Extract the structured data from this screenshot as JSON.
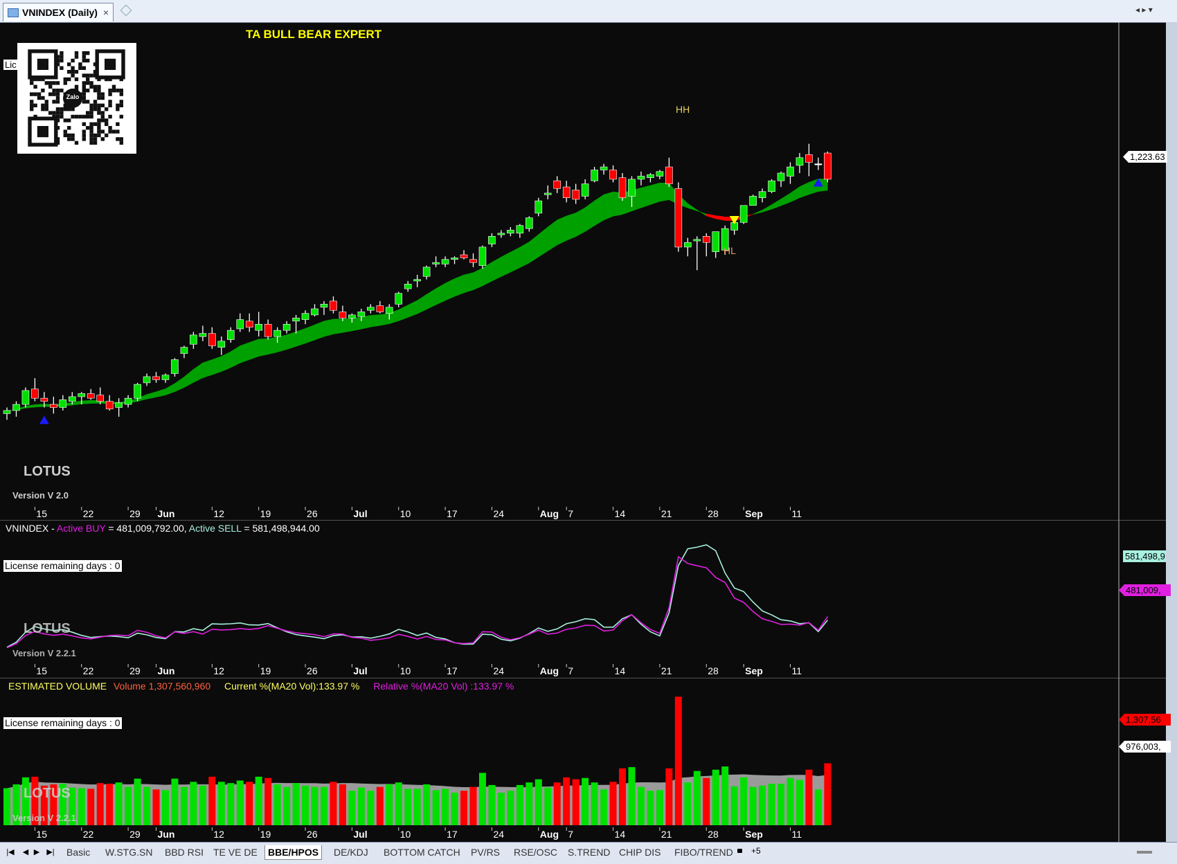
{
  "window": {
    "tab_title": "VNINDEX (Daily)",
    "close_glyph": "×"
  },
  "price_panel": {
    "title": "TA BULL BEAR EXPERT",
    "license_stub": "Lic",
    "qr_label": "Zalo",
    "watermark": "LOTUS",
    "version": "Version V 2.0",
    "last_price_label": "1,223.63",
    "markers": {
      "hh": "HH",
      "hl": "HL"
    },
    "x_labels": [
      "15",
      "22",
      "29",
      "Jun",
      "12",
      "19",
      "26",
      "Jul",
      "10",
      "17",
      "24",
      "Aug",
      "7",
      "14",
      "21",
      "28",
      "Sep",
      "11"
    ]
  },
  "active_panel": {
    "symbol": "VNINDEX - ",
    "buy_label": "Active BUY",
    "buy_text": " = 481,009,792.00, ",
    "sell_label": "Active SELL",
    "sell_text": " = 581,498,944.00",
    "license_text": "License remaining days : 0",
    "watermark": "LOTUS",
    "version": "Version V 2.2.1",
    "sell_tag": "581,498,9",
    "buy_tag": "481,009,"
  },
  "volume_panel": {
    "title": "ESTIMATED VOLUME",
    "volume_text": "Volume 1,307,560,960",
    "current_text": "Current %(MA20 Vol):133.97 %",
    "relative_text": "Relative %(MA20 Vol) :133.97 %",
    "license_text": "License remaining days : 0",
    "watermark": "LOTUS",
    "version": "Version V 2.2.1",
    "vol_tag": "1,307,56",
    "ma_tag": "976,003,"
  },
  "sheet_tabs": [
    "Basic",
    "W.STG.SN",
    "BBD RSI",
    "TE VE DE",
    "BBE/HPOS",
    "DE/KDJ",
    "BOTTOM CATCH",
    "PV/RS",
    "RSE/OSC",
    "S.TREND",
    "CHIP DIS",
    "FIBO/TREND"
  ],
  "active_sheet": "BBE/HPOS",
  "colors": {
    "up": "#00e000",
    "down": "#ff0000",
    "band_up": "#00a000",
    "band_down": "#ff0000",
    "buy_line": "#e020e0",
    "sell_line": "#a8f0e0",
    "vol_ma": "#9a9a9a",
    "title": "#ffff00"
  },
  "chart_data": [
    {
      "type": "candlestick",
      "title": "TA BULL BEAR EXPERT",
      "symbol": "VNINDEX",
      "interval": "Daily",
      "ylim": [
        1040,
        1260
      ],
      "last_close": 1223.63,
      "ohlc": [
        [
          1060,
          1064,
          1056,
          1062
        ],
        [
          1062,
          1068,
          1058,
          1066
        ],
        [
          1066,
          1077,
          1064,
          1075
        ],
        [
          1076,
          1083,
          1068,
          1070
        ],
        [
          1070,
          1074,
          1064,
          1068
        ],
        [
          1066,
          1071,
          1060,
          1064
        ],
        [
          1064,
          1072,
          1062,
          1069
        ],
        [
          1068,
          1074,
          1066,
          1071
        ],
        [
          1071,
          1074,
          1066,
          1073
        ],
        [
          1073,
          1076,
          1069,
          1070
        ],
        [
          1072,
          1077,
          1066,
          1068
        ],
        [
          1068,
          1072,
          1062,
          1063
        ],
        [
          1064,
          1070,
          1058,
          1067
        ],
        [
          1066,
          1072,
          1064,
          1070
        ],
        [
          1070,
          1080,
          1068,
          1079
        ],
        [
          1080,
          1086,
          1078,
          1084
        ],
        [
          1084,
          1087,
          1080,
          1082
        ],
        [
          1082,
          1086,
          1080,
          1085
        ],
        [
          1086,
          1096,
          1084,
          1095
        ],
        [
          1099,
          1104,
          1096,
          1103
        ],
        [
          1105,
          1113,
          1102,
          1111
        ],
        [
          1110,
          1117,
          1107,
          1112
        ],
        [
          1112,
          1116,
          1102,
          1104
        ],
        [
          1103,
          1110,
          1098,
          1107
        ],
        [
          1108,
          1116,
          1106,
          1114
        ],
        [
          1115,
          1125,
          1113,
          1121
        ],
        [
          1120,
          1125,
          1113,
          1116
        ],
        [
          1114,
          1126,
          1110,
          1118
        ],
        [
          1118,
          1121,
          1108,
          1110
        ],
        [
          1110,
          1116,
          1106,
          1114
        ],
        [
          1114,
          1120,
          1112,
          1118
        ],
        [
          1120,
          1124,
          1112,
          1122
        ],
        [
          1121,
          1127,
          1118,
          1125
        ],
        [
          1124,
          1131,
          1123,
          1128
        ],
        [
          1129,
          1133,
          1124,
          1131
        ],
        [
          1133,
          1136,
          1125,
          1127
        ],
        [
          1126,
          1130,
          1120,
          1122
        ],
        [
          1122,
          1125,
          1119,
          1124
        ],
        [
          1123,
          1128,
          1120,
          1126
        ],
        [
          1127,
          1131,
          1125,
          1129
        ],
        [
          1130,
          1133,
          1125,
          1126
        ],
        [
          1125,
          1131,
          1121,
          1129
        ],
        [
          1131,
          1139,
          1129,
          1138
        ],
        [
          1141,
          1146,
          1139,
          1144
        ],
        [
          1146,
          1150,
          1142,
          1147
        ],
        [
          1149,
          1156,
          1147,
          1155
        ],
        [
          1157,
          1162,
          1155,
          1158
        ],
        [
          1157,
          1162,
          1155,
          1160
        ],
        [
          1160,
          1162,
          1157,
          1161
        ],
        [
          1163,
          1166,
          1160,
          1161
        ],
        [
          1160,
          1164,
          1155,
          1158
        ],
        [
          1156,
          1169,
          1154,
          1168
        ],
        [
          1170,
          1177,
          1168,
          1175
        ],
        [
          1176,
          1179,
          1174,
          1177
        ],
        [
          1177,
          1181,
          1175,
          1179
        ],
        [
          1177,
          1183,
          1174,
          1182
        ],
        [
          1180,
          1188,
          1178,
          1187
        ],
        [
          1190,
          1200,
          1188,
          1198
        ],
        [
          1202,
          1208,
          1199,
          1203
        ],
        [
          1211,
          1214,
          1203,
          1206
        ],
        [
          1207,
          1211,
          1197,
          1200
        ],
        [
          1205,
          1209,
          1196,
          1199
        ],
        [
          1201,
          1212,
          1199,
          1209
        ],
        [
          1211,
          1220,
          1210,
          1218
        ],
        [
          1218,
          1222,
          1215,
          1220
        ],
        [
          1218,
          1221,
          1210,
          1212
        ],
        [
          1213,
          1216,
          1198,
          1200
        ],
        [
          1201,
          1214,
          1194,
          1212
        ],
        [
          1212,
          1217,
          1208,
          1214
        ],
        [
          1213,
          1216,
          1210,
          1215
        ],
        [
          1214,
          1218,
          1212,
          1217
        ],
        [
          1220,
          1226,
          1207,
          1209
        ],
        [
          1206,
          1210,
          1165,
          1168
        ],
        [
          1168,
          1174,
          1162,
          1171
        ],
        [
          1172,
          1175,
          1153,
          1173
        ],
        [
          1175,
          1177,
          1162,
          1171
        ],
        [
          1165,
          1178,
          1161,
          1178
        ],
        [
          1166,
          1182,
          1163,
          1180
        ],
        [
          1179,
          1184,
          1176,
          1184
        ],
        [
          1184,
          1195,
          1183,
          1195
        ],
        [
          1195,
          1202,
          1195,
          1201
        ],
        [
          1200,
          1206,
          1197,
          1204
        ],
        [
          1204,
          1212,
          1203,
          1211
        ],
        [
          1211,
          1217,
          1207,
          1216
        ],
        [
          1214,
          1223,
          1209,
          1220
        ],
        [
          1221,
          1229,
          1216,
          1226
        ],
        [
          1228,
          1235,
          1214,
          1223
        ],
        [
          1222,
          1226,
          1218,
          1222
        ],
        [
          1229,
          1230,
          1210,
          1212
        ]
      ]
    },
    {
      "type": "line",
      "title": "VNINDEX - Active BUY / Active SELL",
      "series": [
        {
          "name": "Active BUY",
          "last_value": 481009792.0
        },
        {
          "name": "Active SELL",
          "last_value": 581498944.0
        }
      ]
    },
    {
      "type": "bar",
      "title": "ESTIMATED VOLUME",
      "last_volume": 1307560960,
      "current_pct_ma20": 133.97,
      "relative_pct_ma20": 133.97,
      "ma_last_label": "976,003,"
    }
  ]
}
